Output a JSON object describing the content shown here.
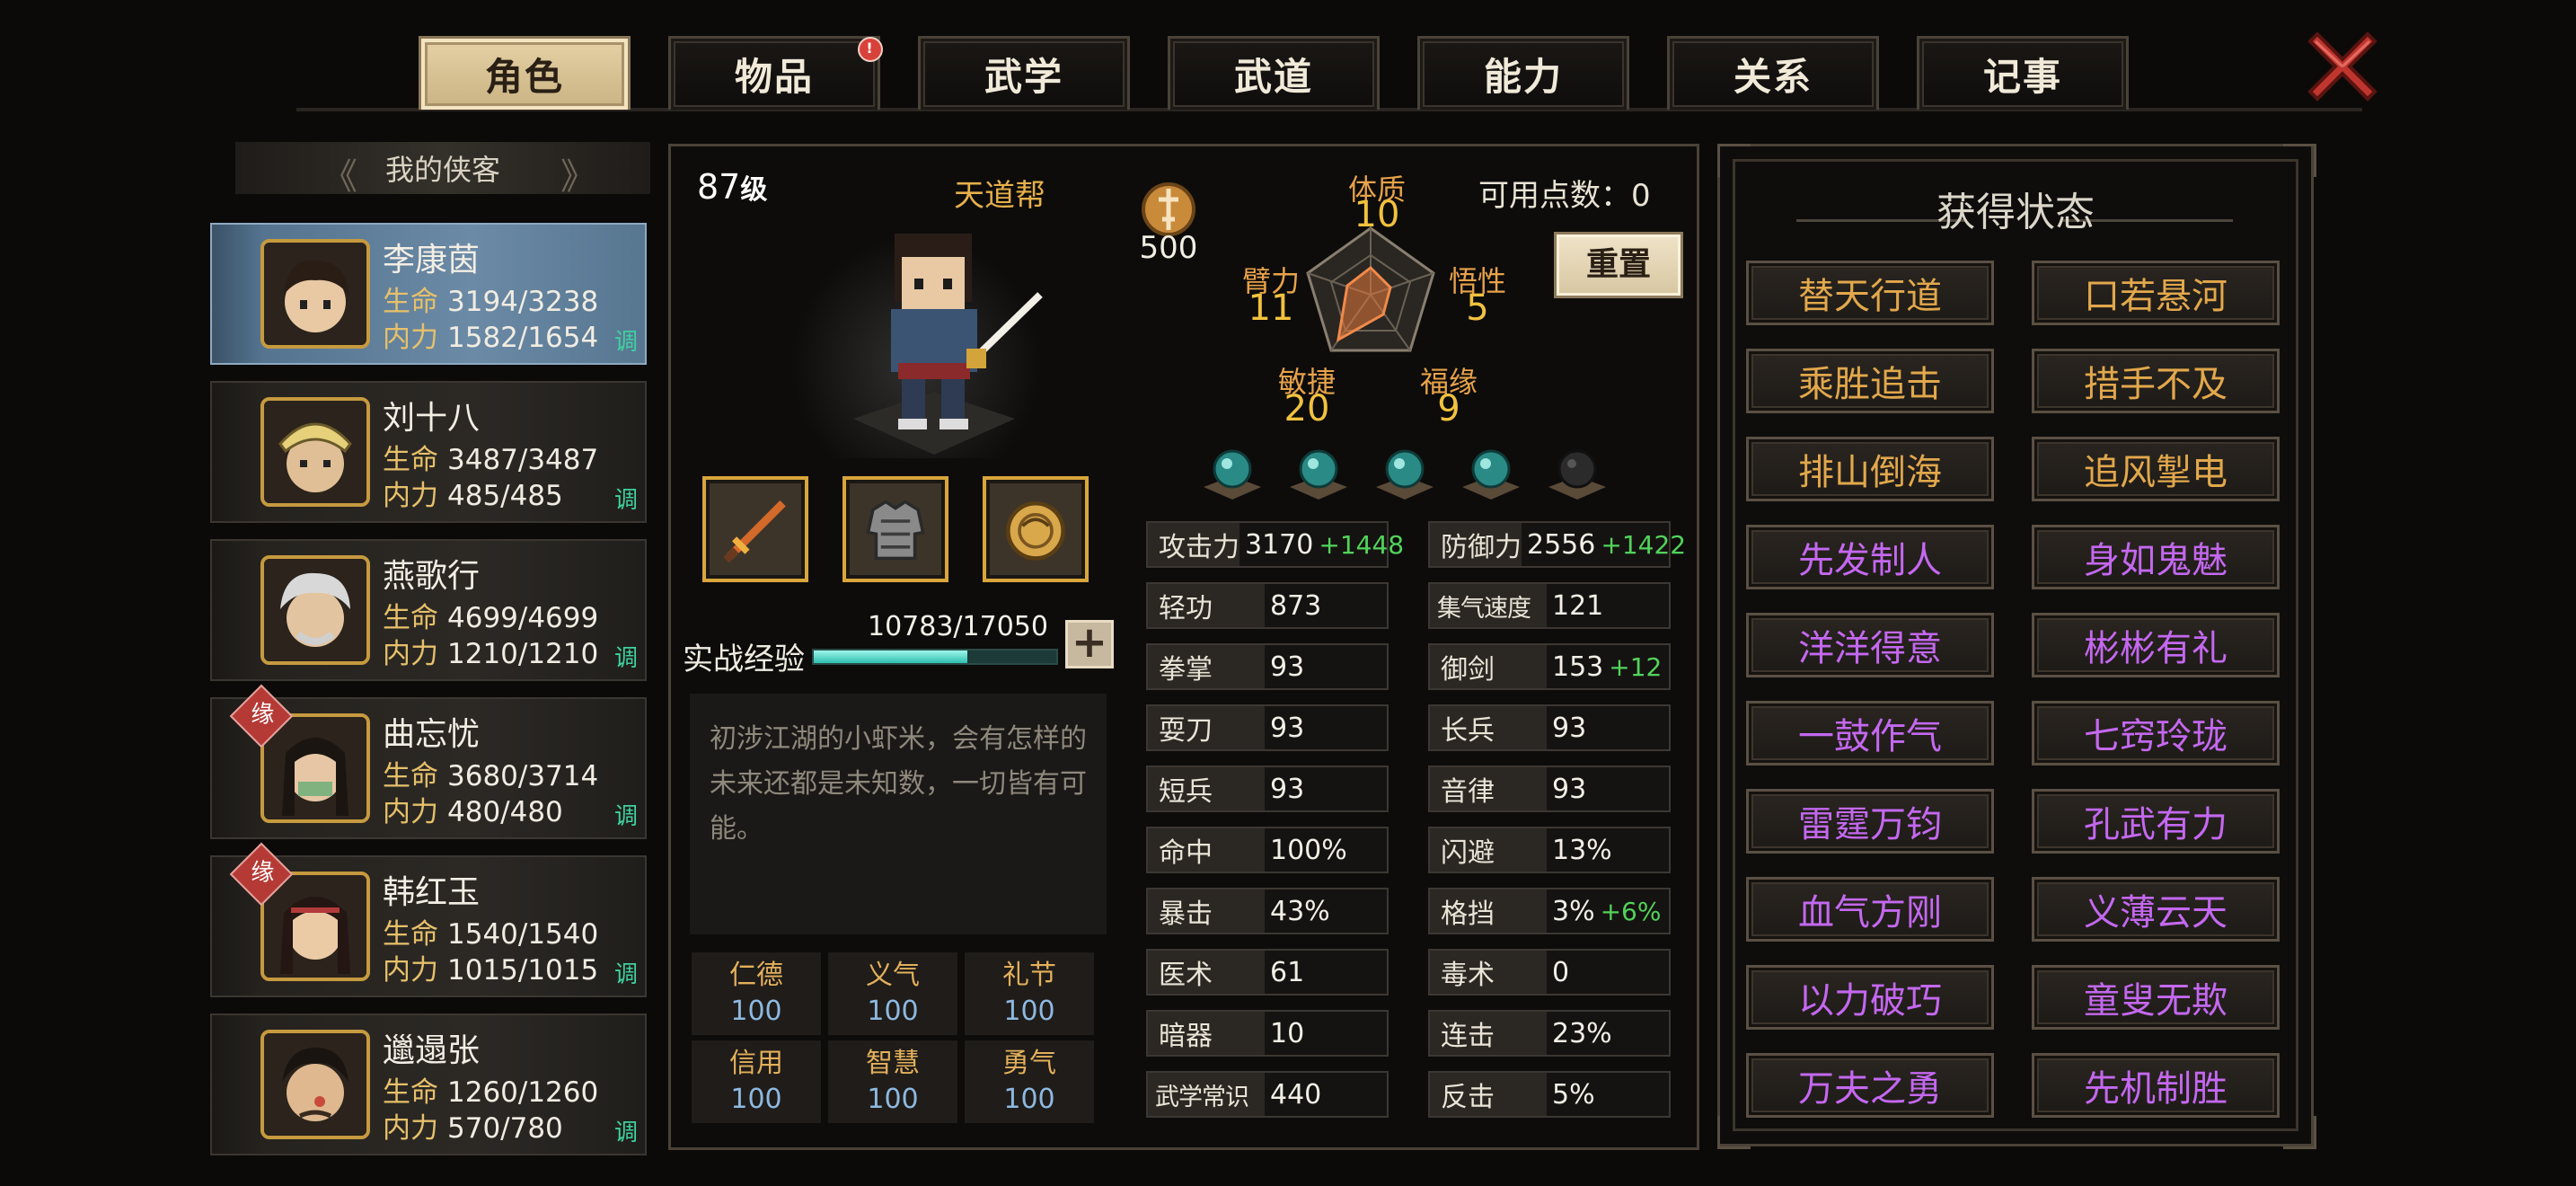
{
  "tabs": [
    {
      "label": "角色",
      "active": true
    },
    {
      "label": "物品",
      "active": false,
      "badge": "!"
    },
    {
      "label": "武学",
      "active": false
    },
    {
      "label": "武道",
      "active": false
    },
    {
      "label": "能力",
      "active": false
    },
    {
      "label": "关系",
      "active": false
    },
    {
      "label": "记事",
      "active": false
    }
  ],
  "hero_list": {
    "header": "我的侠客",
    "hp_label": "生命",
    "mp_label": "内力",
    "adjust_label": "调",
    "yuan_label": "缘",
    "heroes": [
      {
        "name": "李康茵",
        "hp": "3194/3238",
        "mp": "1582/1654",
        "selected": true,
        "yuan": false
      },
      {
        "name": "刘十八",
        "hp": "3487/3487",
        "mp": "485/485",
        "selected": false,
        "yuan": false
      },
      {
        "name": "燕歌行",
        "hp": "4699/4699",
        "mp": "1210/1210",
        "selected": false,
        "yuan": false
      },
      {
        "name": "曲忘忧",
        "hp": "3680/3714",
        "mp": "480/480",
        "selected": false,
        "yuan": true
      },
      {
        "name": "韩红玉",
        "hp": "1540/1540",
        "mp": "1015/1015",
        "selected": false,
        "yuan": true
      },
      {
        "name": "邋遢张",
        "hp": "1260/1260",
        "mp": "570/780",
        "selected": false,
        "yuan": false
      }
    ]
  },
  "character": {
    "level": "87",
    "level_suffix": "级",
    "sect": "天道帮",
    "points_total": "500",
    "available_points": "可用点数：0",
    "reset_label": "重置",
    "attributes": {
      "tizhi": {
        "label": "体质",
        "value": "10"
      },
      "wuxing": {
        "label": "悟性",
        "value": "5"
      },
      "fuyuan": {
        "label": "福缘",
        "value": "9"
      },
      "minjie": {
        "label": "敏捷",
        "value": "20"
      },
      "bili": {
        "label": "臂力",
        "value": "11"
      }
    },
    "gems": [
      "teal",
      "teal",
      "teal",
      "teal",
      "empty"
    ],
    "equipment": [
      "sword-icon",
      "armor-icon",
      "accessory-icon"
    ],
    "exp_label": "实战经验",
    "exp_value": "10783/17050",
    "exp_fraction": 0.632,
    "description": "初涉江湖的小虾米，会有怎样的未来还都是未知数，一切皆有可能。",
    "virtues": [
      {
        "label": "仁德",
        "value": "100"
      },
      {
        "label": "义气",
        "value": "100"
      },
      {
        "label": "礼节",
        "value": "100"
      },
      {
        "label": "信用",
        "value": "100"
      },
      {
        "label": "智慧",
        "value": "100"
      },
      {
        "label": "勇气",
        "value": "100"
      }
    ]
  },
  "stats_left": [
    {
      "label": "攻击力",
      "value": "3170",
      "bonus": "+1448"
    },
    {
      "label": "轻功",
      "value": "873",
      "bonus": ""
    },
    {
      "label": "拳掌",
      "value": "93",
      "bonus": ""
    },
    {
      "label": "耍刀",
      "value": "93",
      "bonus": ""
    },
    {
      "label": "短兵",
      "value": "93",
      "bonus": ""
    },
    {
      "label": "命中",
      "value": "100%",
      "bonus": ""
    },
    {
      "label": "暴击",
      "value": "43%",
      "bonus": ""
    },
    {
      "label": "医术",
      "value": "61",
      "bonus": ""
    },
    {
      "label": "暗器",
      "value": "10",
      "bonus": ""
    },
    {
      "label": "武学常识",
      "value": "440",
      "bonus": ""
    }
  ],
  "stats_right": [
    {
      "label": "防御力",
      "value": "2556",
      "bonus": "+1422"
    },
    {
      "label": "集气速度",
      "value": "121",
      "bonus": ""
    },
    {
      "label": "御剑",
      "value": "153",
      "bonus": "+12"
    },
    {
      "label": "长兵",
      "value": "93",
      "bonus": ""
    },
    {
      "label": "音律",
      "value": "93",
      "bonus": ""
    },
    {
      "label": "闪避",
      "value": "13%",
      "bonus": ""
    },
    {
      "label": "格挡",
      "value": "3%",
      "bonus": "+6%"
    },
    {
      "label": "毒术",
      "value": "0",
      "bonus": ""
    },
    {
      "label": "连击",
      "value": "23%",
      "bonus": ""
    },
    {
      "label": "反击",
      "value": "5%",
      "bonus": ""
    }
  ],
  "status_panel": {
    "title": "获得状态",
    "items": [
      {
        "label": "替天行道",
        "color": "#e2a84c"
      },
      {
        "label": "口若悬河",
        "color": "#e2a84c"
      },
      {
        "label": "乘胜追击",
        "color": "#e2a84c"
      },
      {
        "label": "措手不及",
        "color": "#e2a84c"
      },
      {
        "label": "排山倒海",
        "color": "#e2a84c"
      },
      {
        "label": "追风掣电",
        "color": "#e2a84c"
      },
      {
        "label": "先发制人",
        "color": "#c468f0"
      },
      {
        "label": "身如鬼魅",
        "color": "#c468f0"
      },
      {
        "label": "洋洋得意",
        "color": "#c468f0"
      },
      {
        "label": "彬彬有礼",
        "color": "#c468f0"
      },
      {
        "label": "一鼓作气",
        "color": "#c468f0"
      },
      {
        "label": "七窍玲珑",
        "color": "#c468f0"
      },
      {
        "label": "雷霆万钧",
        "color": "#c468f0"
      },
      {
        "label": "孔武有力",
        "color": "#c468f0"
      },
      {
        "label": "血气方刚",
        "color": "#c468f0"
      },
      {
        "label": "义薄云天",
        "color": "#c468f0"
      },
      {
        "label": "以力破巧",
        "color": "#c468f0"
      },
      {
        "label": "童叟无欺",
        "color": "#c468f0"
      },
      {
        "label": "万夫之勇",
        "color": "#c468f0"
      },
      {
        "label": "先机制胜",
        "color": "#c468f0"
      }
    ]
  }
}
